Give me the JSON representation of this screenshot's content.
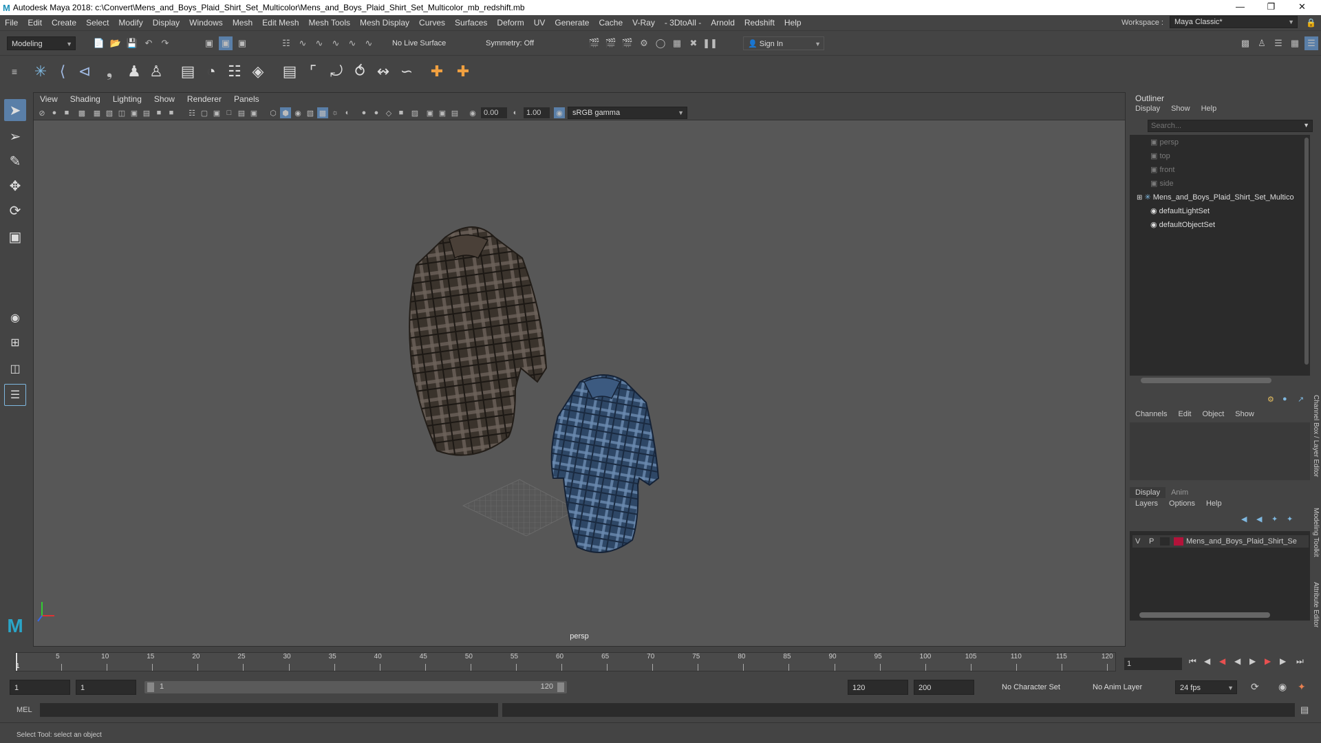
{
  "window": {
    "title": "Autodesk Maya 2018: c:\\Convert\\Mens_and_Boys_Plaid_Shirt_Set_Multicolor\\Mens_and_Boys_Plaid_Shirt_Set_Multicolor_mb_redshift.mb"
  },
  "menu": [
    "File",
    "Edit",
    "Create",
    "Select",
    "Modify",
    "Display",
    "Windows",
    "Mesh",
    "Edit Mesh",
    "Mesh Tools",
    "Mesh Display",
    "Curves",
    "Surfaces",
    "Deform",
    "UV",
    "Generate",
    "Cache",
    "V-Ray",
    "- 3DtoAll -",
    "Arnold",
    "Redshift",
    "Help"
  ],
  "workspace": {
    "label": "Workspace :",
    "value": "Maya Classic*"
  },
  "status": {
    "mode": "Modeling",
    "live_surface": "No Live Surface",
    "symmetry": "Symmetry: Off",
    "sign_in": "Sign In"
  },
  "viewport": {
    "menu": [
      "View",
      "Shading",
      "Lighting",
      "Show",
      "Renderer",
      "Panels"
    ],
    "exposure": "0.00",
    "gamma": "1.00",
    "color_space": "sRGB gamma",
    "camera_label": "persp"
  },
  "outliner": {
    "title": "Outliner",
    "menu": [
      "Display",
      "Show",
      "Help"
    ],
    "search_placeholder": "Search...",
    "items": [
      {
        "name": "persp",
        "type": "camera",
        "dim": true
      },
      {
        "name": "top",
        "type": "camera",
        "dim": true
      },
      {
        "name": "front",
        "type": "camera",
        "dim": true
      },
      {
        "name": "side",
        "type": "camera",
        "dim": true
      },
      {
        "name": "Mens_and_Boys_Plaid_Shirt_Set_Multico",
        "type": "group",
        "dim": false
      },
      {
        "name": "defaultLightSet",
        "type": "set",
        "dim": false
      },
      {
        "name": "defaultObjectSet",
        "type": "set",
        "dim": false
      }
    ]
  },
  "channel_box": {
    "menu": [
      "Channels",
      "Edit",
      "Object",
      "Show"
    ]
  },
  "layer_editor": {
    "tabs": [
      "Display",
      "Anim"
    ],
    "menu": [
      "Layers",
      "Options",
      "Help"
    ],
    "layers": [
      {
        "v": "V",
        "p": "P",
        "name": "Mens_and_Boys_Plaid_Shirt_Se",
        "color": "#b3133a"
      }
    ]
  },
  "side_tabs": [
    "Channel Box / Layer Editor",
    "Modeling Toolkit",
    "Attribute Editor"
  ],
  "timeline": {
    "ticks": [
      "5",
      "10",
      "15",
      "20",
      "25",
      "30",
      "35",
      "40",
      "45",
      "50",
      "55",
      "60",
      "65",
      "70",
      "75",
      "80",
      "85",
      "90",
      "95",
      "100",
      "105",
      "110",
      "115",
      "120"
    ],
    "current_frame": "1",
    "first_tick": "1",
    "frame_field": "1"
  },
  "range": {
    "start": "1",
    "current": "1",
    "range_start": "1",
    "range_end": "120",
    "end": "120",
    "max": "200",
    "character_set": "No Character Set",
    "anim_layer": "No Anim Layer",
    "fps": "24 fps"
  },
  "command": {
    "label": "MEL"
  },
  "help_line": "Select Tool: select an object"
}
